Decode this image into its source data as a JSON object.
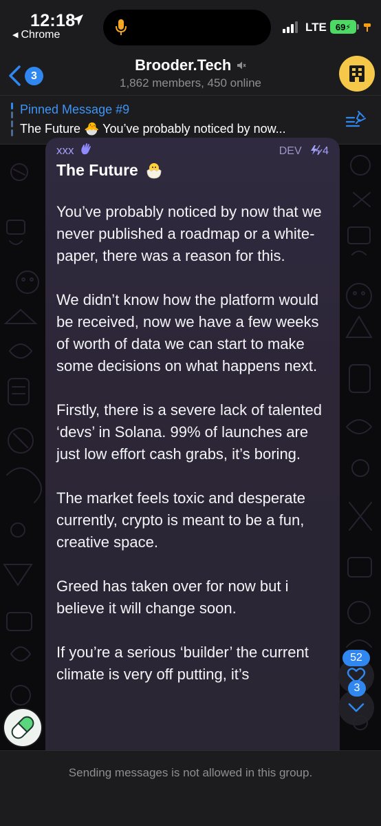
{
  "status_bar": {
    "time": "12:18",
    "back_app": "Chrome",
    "network": "LTE",
    "battery": "69"
  },
  "header": {
    "back_badge": "3",
    "title": "Brooder.Tech",
    "subtitle": "1,862 members, 450 online",
    "avatar_icon": "building-logo-icon"
  },
  "pinned": {
    "title": "Pinned Message #9",
    "text": "The Future 🐣 You’ve probably noticed by now..."
  },
  "message": {
    "sender": "xxx",
    "tag": "DEV",
    "boosts": "4",
    "title": "The Future",
    "paragraphs": [
      "You’ve probably noticed by now that we never published a roadmap or a white-paper, there was a reason for this.",
      "We didn’t know how the platform would be received, now we have a few weeks of worth of data we can start to make some decisions on what happens next.",
      "Firstly, there is a severe lack of talented ‘devs’ in Solana. 99% of launches are just low effort cash grabs, it’s boring.",
      "The market feels toxic and desperate currently, crypto is meant to be a fun, creative space.",
      "Greed has taken over for now but i believe it will change soon.",
      "If you’re a serious ‘builder’ the current climate is very off putting, it’s"
    ]
  },
  "reactions_badge": "52",
  "scroll_down_badge": "3",
  "footer": {
    "text": "Sending messages is not allowed in this group."
  },
  "colors": {
    "accent": "#2f87ef",
    "sender_name": "#a4a0f8",
    "battery": "#4cd964",
    "group_avatar": "#f5c84a"
  }
}
